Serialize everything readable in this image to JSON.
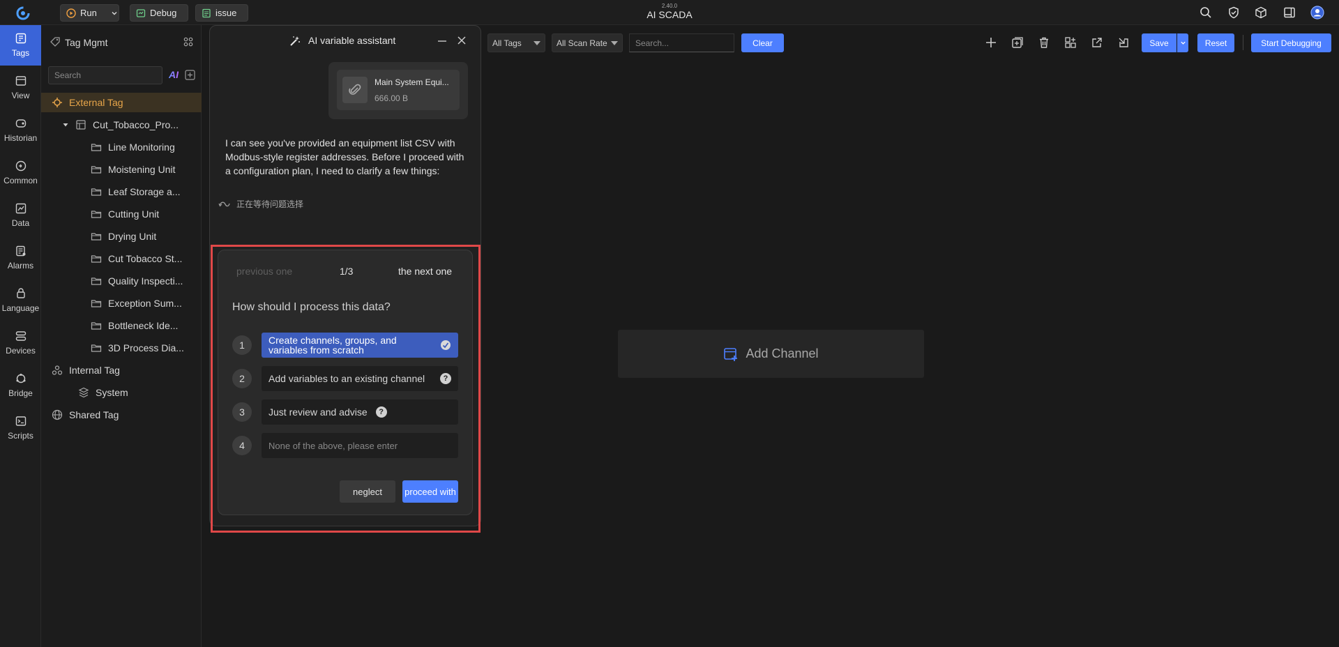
{
  "colors": {
    "accent": "#4d7fff",
    "selected_tree": "#e7a54a",
    "highlight_box": "#e04848"
  },
  "topbar": {
    "run_label": "Run",
    "debug_label": "Debug",
    "issue_label": "issue",
    "version": "2.40.0",
    "app_name": "AI SCADA",
    "icons": [
      "search-icon",
      "shield-check-icon",
      "cube-icon",
      "panel-icon",
      "user-icon"
    ]
  },
  "rail": {
    "items": [
      {
        "label": "Tags",
        "icon": "tags-icon",
        "active": true
      },
      {
        "label": "View",
        "icon": "view-icon"
      },
      {
        "label": "Historian",
        "icon": "historian-icon"
      },
      {
        "label": "Common",
        "icon": "common-icon"
      },
      {
        "label": "Data",
        "icon": "data-icon"
      },
      {
        "label": "Alarms",
        "icon": "alarms-icon"
      },
      {
        "label": "Language",
        "icon": "language-icon"
      },
      {
        "label": "Devices",
        "icon": "devices-icon"
      },
      {
        "label": "Bridge",
        "icon": "bridge-icon"
      },
      {
        "label": "Scripts",
        "icon": "scripts-icon"
      }
    ]
  },
  "tag_panel": {
    "title": "Tag Mgmt",
    "search_placeholder": "Search",
    "ai_label": "AI",
    "tree": [
      {
        "label": "External Tag",
        "level": 0,
        "icon": "external-tag-icon",
        "selected": true
      },
      {
        "label": "Cut_Tobacco_Pro...",
        "level": 1,
        "icon": "table-icon",
        "expanded": true
      },
      {
        "label": "Line Monitoring",
        "level": 2,
        "icon": "folder-icon"
      },
      {
        "label": "Moistening Unit",
        "level": 2,
        "icon": "folder-icon"
      },
      {
        "label": "Leaf Storage a...",
        "level": 2,
        "icon": "folder-icon"
      },
      {
        "label": "Cutting Unit",
        "level": 2,
        "icon": "folder-icon"
      },
      {
        "label": "Drying Unit",
        "level": 2,
        "icon": "folder-icon"
      },
      {
        "label": "Cut Tobacco St...",
        "level": 2,
        "icon": "folder-icon"
      },
      {
        "label": "Quality Inspecti...",
        "level": 2,
        "icon": "folder-icon"
      },
      {
        "label": "Exception Sum...",
        "level": 2,
        "icon": "folder-icon"
      },
      {
        "label": "Bottleneck Ide...",
        "level": 2,
        "icon": "folder-icon"
      },
      {
        "label": "3D Process Dia...",
        "level": 2,
        "icon": "folder-icon"
      },
      {
        "label": "Internal Tag",
        "level": 0,
        "icon": "internal-tag-icon"
      },
      {
        "label": "System",
        "level": 1,
        "icon": "system-icon"
      },
      {
        "label": "Shared Tag",
        "level": 0,
        "icon": "globe-icon"
      }
    ]
  },
  "filters": {
    "tags_select": "All Tags",
    "scan_rate_select": "All Scan Rate",
    "search_placeholder": "Search...",
    "clear_label": "Clear"
  },
  "toolbar": {
    "save_label": "Save",
    "reset_label": "Reset",
    "start_debug_label": "Start Debugging",
    "icons": [
      "add-icon",
      "add-group-icon",
      "delete-icon",
      "layout-icon",
      "export-icon",
      "import-icon"
    ]
  },
  "main": {
    "add_channel_label": "Add Channel"
  },
  "ai_assistant": {
    "title": "AI variable assistant",
    "file": {
      "name": "Main System Equi...",
      "size": "666.00 B"
    },
    "message": "I can see you've provided an equipment list CSV with Modbus-style register addresses. Before I proceed with a configuration plan, I need to clarify a few things:",
    "status": "正在等待问题选择",
    "question": {
      "prev_label": "previous one",
      "page": "1/3",
      "next_label": "the next one",
      "title": "How should I process this data?",
      "options": [
        {
          "num": "1",
          "label": "Create channels, groups, and variables from scratch",
          "selected": true
        },
        {
          "num": "2",
          "label": "Add variables to an existing channel"
        },
        {
          "num": "3",
          "label": "Just review and advise"
        },
        {
          "num": "4",
          "placeholder": "None of the above, please enter"
        }
      ],
      "neglect_label": "neglect",
      "proceed_label": "proceed with"
    }
  }
}
